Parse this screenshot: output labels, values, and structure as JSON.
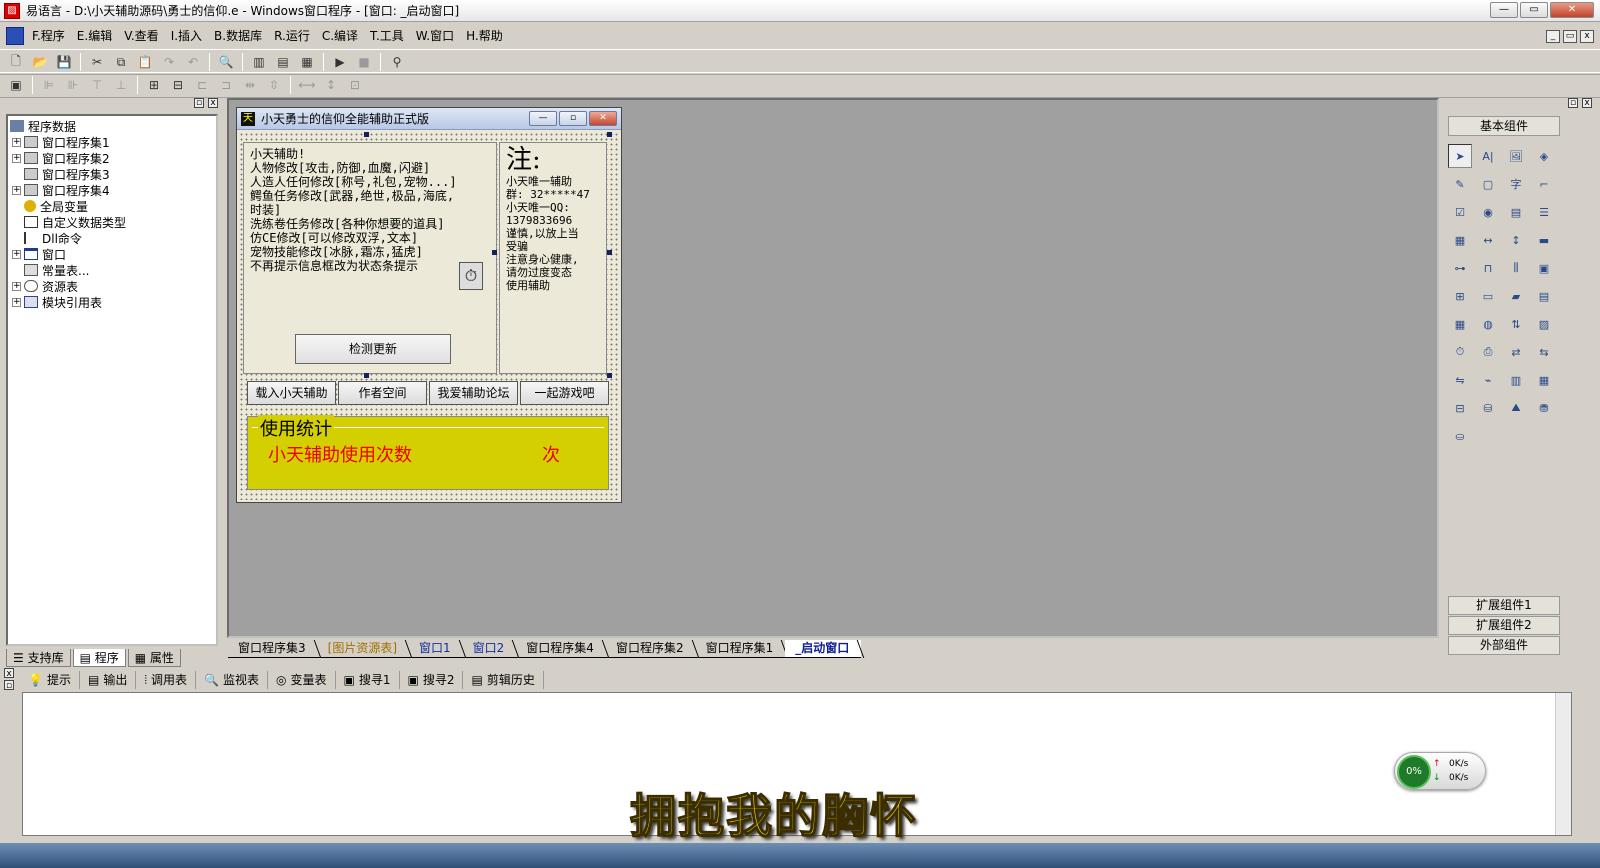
{
  "window": {
    "title": "易语言 - D:\\小天辅助源码\\勇士的信仰.e - Windows窗口程序 - [窗口: _启动窗口]",
    "min": "—",
    "max": "▭",
    "close": "✕"
  },
  "menu": [
    "F.程序",
    "E.编辑",
    "V.查看",
    "I.插入",
    "B.数据库",
    "R.运行",
    "C.编译",
    "T.工具",
    "W.窗口",
    "H.帮助"
  ],
  "left_panel": {
    "tree": [
      {
        "label": "程序数据",
        "toggle": "",
        "icon": "db"
      },
      {
        "label": "窗口程序集1",
        "toggle": "+",
        "icon": "module"
      },
      {
        "label": "窗口程序集2",
        "toggle": "+",
        "icon": "module"
      },
      {
        "label": "窗口程序集3",
        "toggle": "",
        "icon": "module"
      },
      {
        "label": "窗口程序集4",
        "toggle": "+",
        "icon": "module"
      },
      {
        "label": "全局变量",
        "toggle": "",
        "icon": "global"
      },
      {
        "label": "自定义数据类型",
        "toggle": "",
        "icon": "type"
      },
      {
        "label": "Dll命令",
        "toggle": "",
        "icon": "dll"
      },
      {
        "label": "窗口",
        "toggle": "+",
        "icon": "window"
      },
      {
        "label": "常量表...",
        "toggle": "",
        "icon": "const"
      },
      {
        "label": "资源表",
        "toggle": "+",
        "icon": "res"
      },
      {
        "label": "模块引用表",
        "toggle": "+",
        "icon": "mod"
      }
    ],
    "tabs": [
      "支持库",
      "程序",
      "属性"
    ]
  },
  "form": {
    "title": "小天勇士的信仰全能辅助正式版",
    "left_lines": [
      "小天辅助!",
      "人物修改[攻击,防御,血魔,闪避]",
      "人造人任何修改[称号,礼包,宠物...]",
      "鳄鱼任务修改[武器,绝世,极品,海底,",
      "时装]",
      "洗练卷任务修改[各种你想要的道具]",
      "仿CE修改[可以修改双浮,文本]",
      "宠物技能修改[冰脉,霜冻,猛虎]",
      "不再提示信息框改为状态条提示"
    ],
    "right_title": "注:",
    "right_lines": [
      "小天唯一辅助",
      "群: 32*****47",
      "小天唯一QQ:",
      "1379833696",
      "谨慎,以放上当",
      "受骗",
      "注意身心健康,",
      "请勿过度变态",
      "使用辅助"
    ],
    "check_button": "检测更新",
    "buttons": [
      "载入小天辅助",
      "作者空间",
      "我爱辅助论坛",
      "一起游戏吧"
    ],
    "stat_legend": "使用统计",
    "stat_text": "小天辅助使用次数",
    "stat_unit": "次"
  },
  "right_panel": {
    "title": "基本组件",
    "buttons": [
      "扩展组件1",
      "扩展组件2",
      "外部组件"
    ]
  },
  "doc_tabs": [
    "窗口程序集3",
    "[图片资源表]",
    "窗口1",
    "窗口2",
    "窗口程序集4",
    "窗口程序集2",
    "窗口程序集1",
    "_启动窗口"
  ],
  "bottom_tabs": [
    "提示",
    "输出",
    "调用表",
    "监视表",
    "变量表",
    "搜寻1",
    "搜寻2",
    "剪辑历史"
  ],
  "net_widget": {
    "percent": "0%",
    "up": "0K/s",
    "down": "0K/s"
  },
  "caption": "拥抱我的胸怀"
}
